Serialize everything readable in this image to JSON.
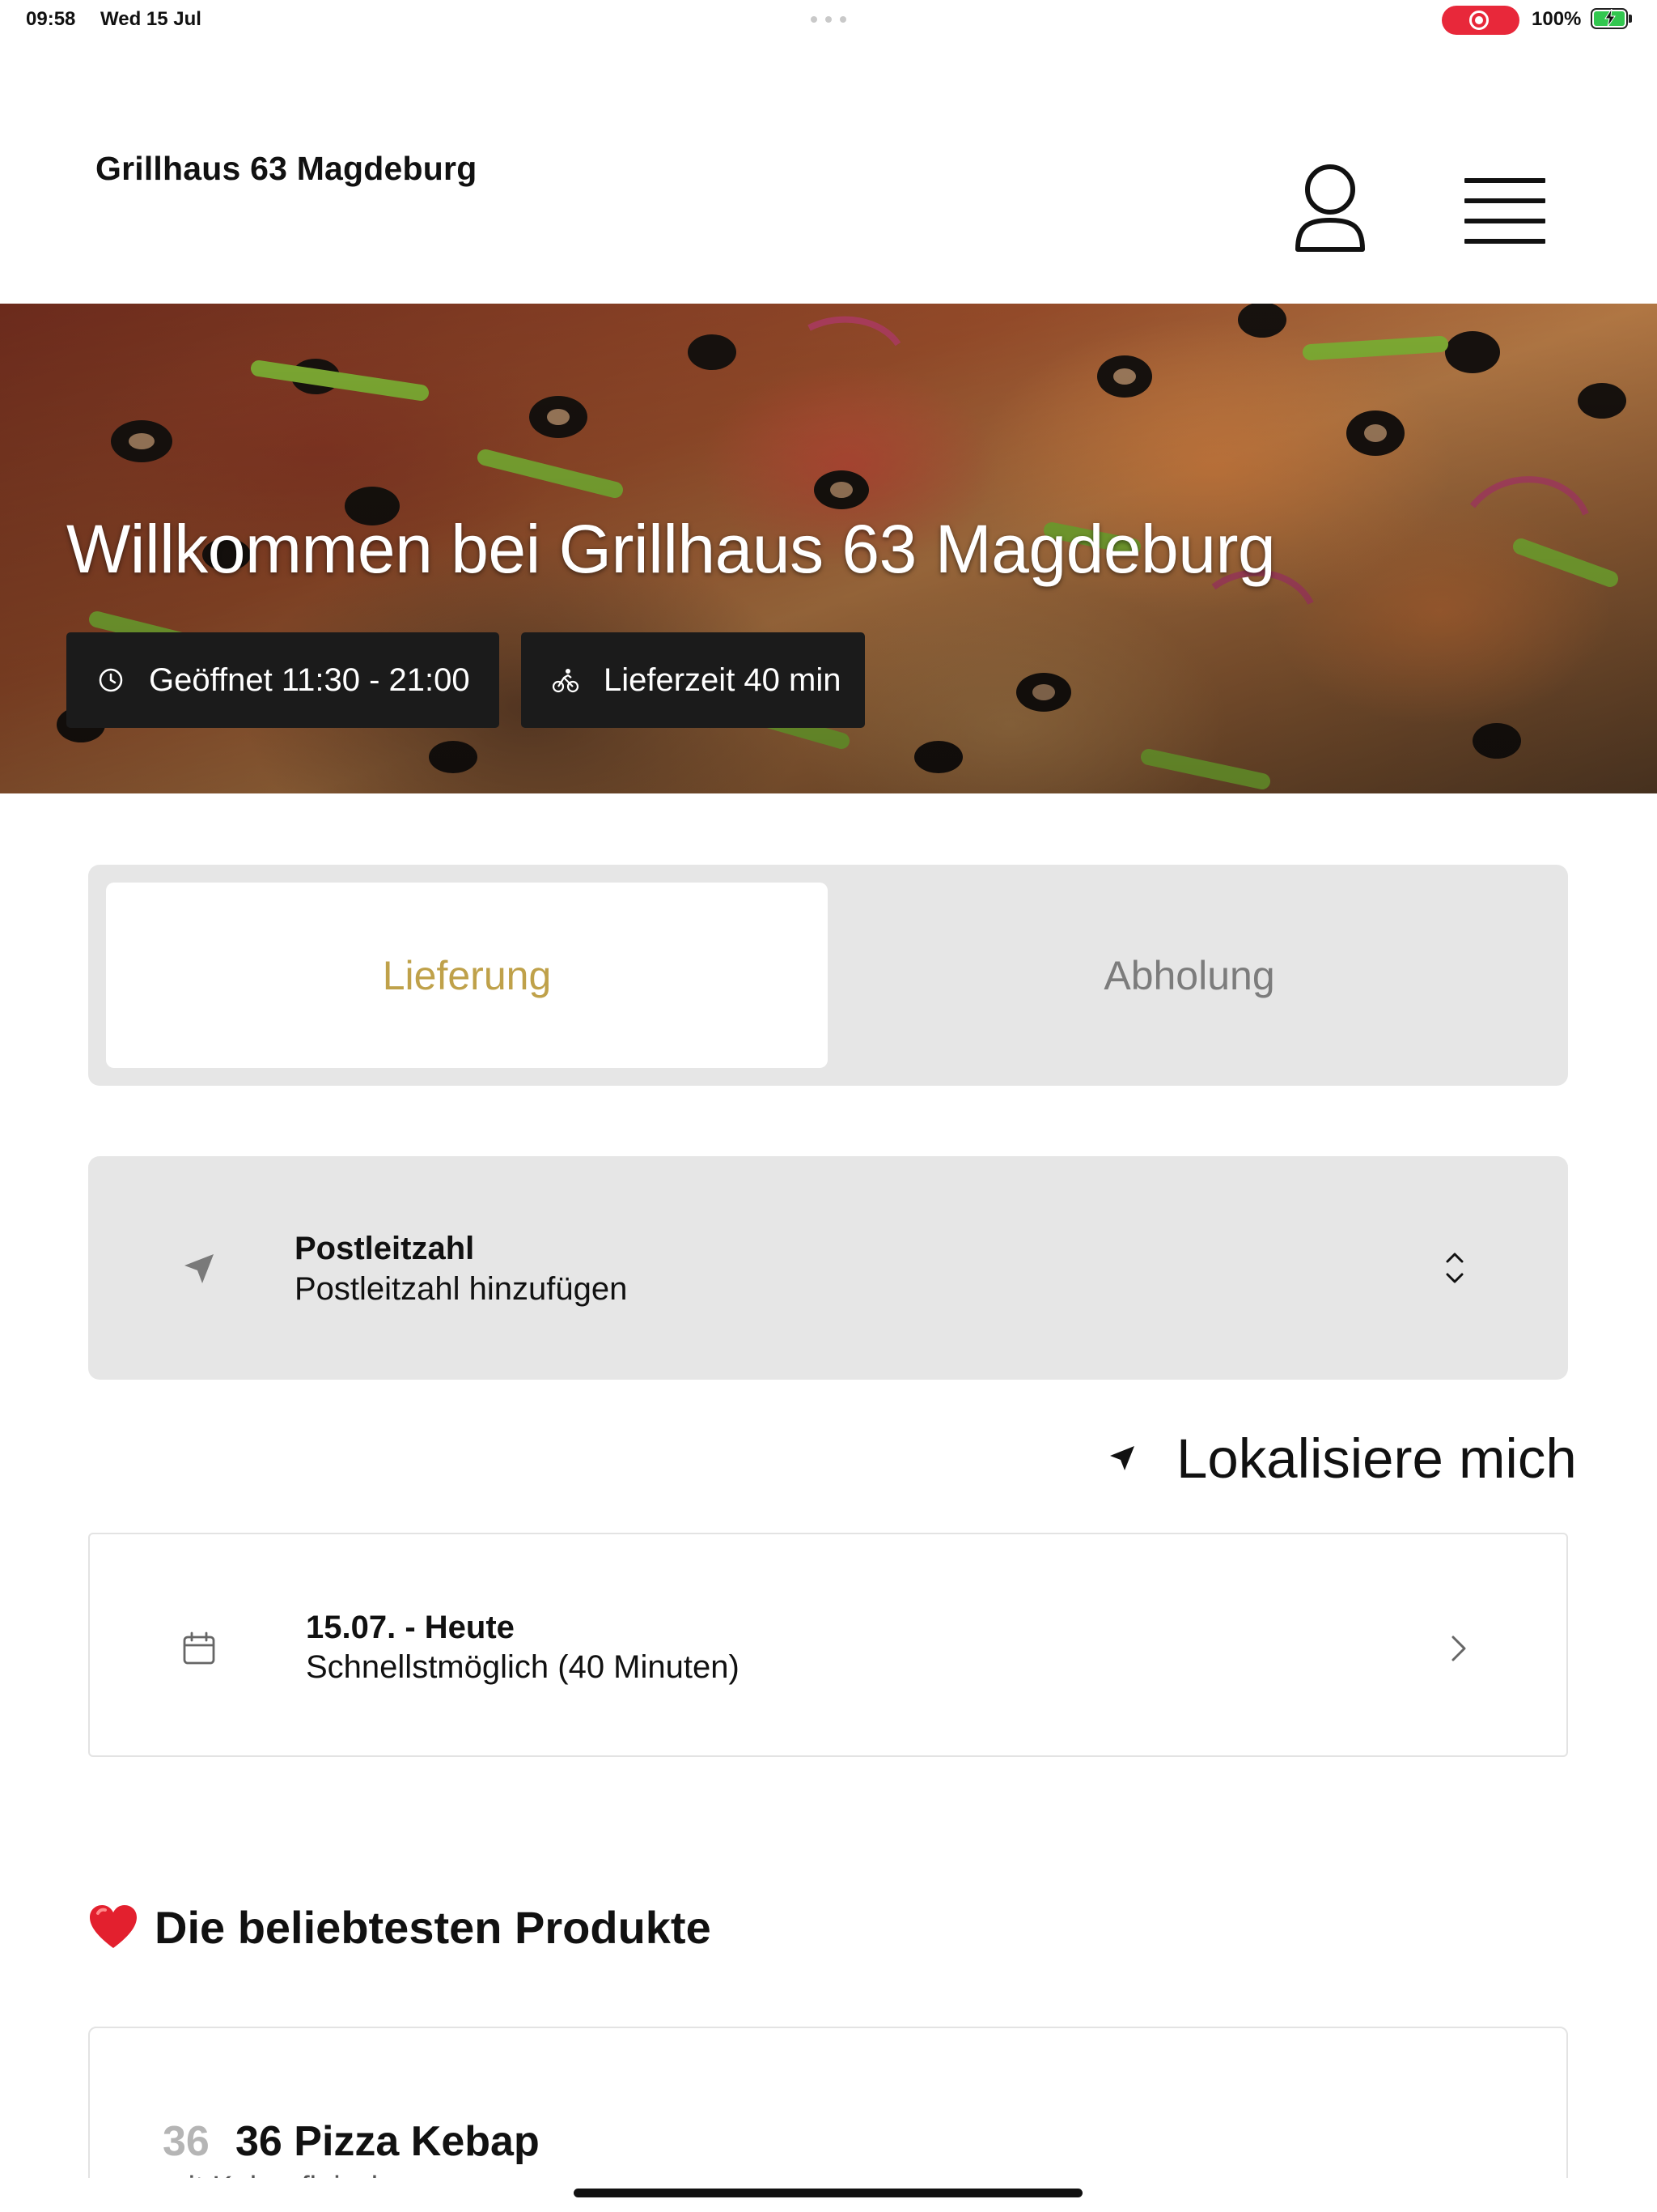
{
  "status_bar": {
    "time": "09:58",
    "date": "Wed 15 Jul",
    "battery_percent": "100%",
    "battery_level": 1.0,
    "recording_color": "#e8283a"
  },
  "header": {
    "brand": "Grillhaus 63 Magdeburg",
    "profile_icon": "person-icon",
    "menu_icon": "hamburger-menu-icon"
  },
  "hero": {
    "title": "Willkommen bei Grillhaus 63 Magdeburg",
    "opening_hours": "Geöffnet 11:30 - 21:00",
    "delivery_time": "Lieferzeit 40 min",
    "opening_icon": "clock-icon",
    "delivery_icon": "cyclist-icon"
  },
  "order_mode": {
    "tabs": [
      {
        "label": "Lieferung",
        "active": true
      },
      {
        "label": "Abholung",
        "active": false
      }
    ],
    "accent_color": "#bfa14a"
  },
  "postcode": {
    "title": "Postleitzahl",
    "value": "Postleitzahl hinzufügen",
    "icon": "location-arrow-icon"
  },
  "locate": {
    "label": "Lokalisiere mich",
    "icon": "location-arrow-icon"
  },
  "delivery_time_picker": {
    "title": "15.07. - Heute",
    "subtitle": "Schnellstmöglich (40 Minuten)",
    "icon": "calendar-icon"
  },
  "popular": {
    "title": "Die beliebtesten Produkte",
    "icon": "heart-icon",
    "products": [
      {
        "number": "36",
        "name": "36 Pizza Kebap",
        "description": "mit Kebapfleisch"
      }
    ]
  }
}
